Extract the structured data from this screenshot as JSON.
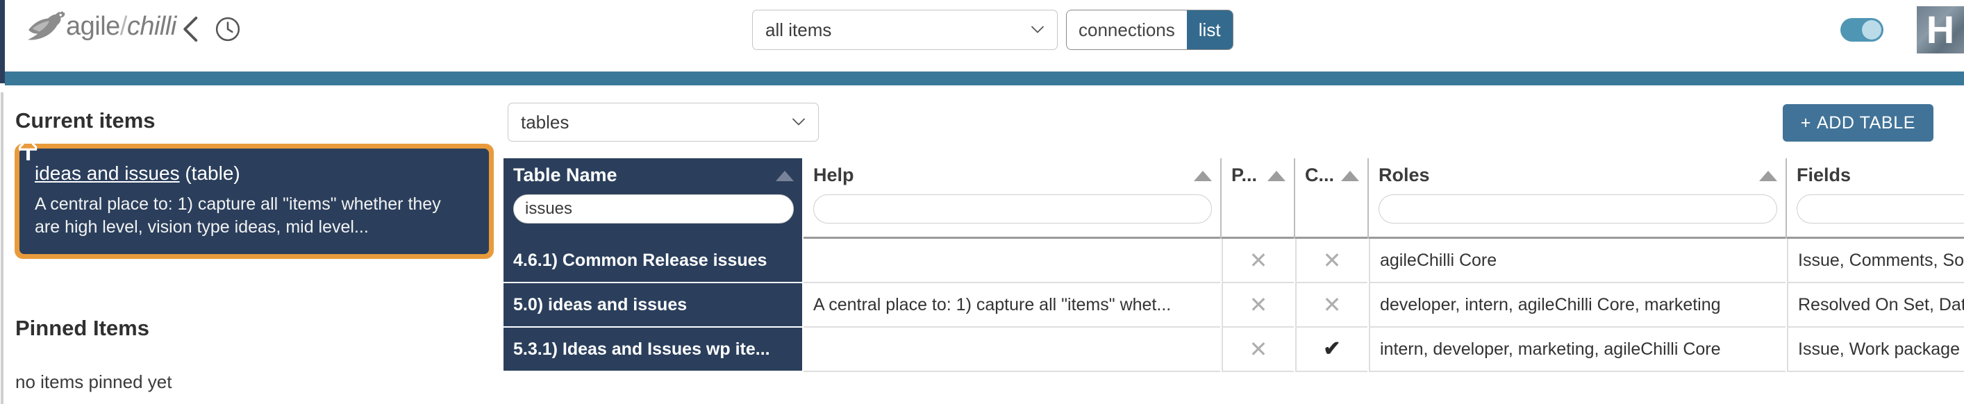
{
  "header": {
    "logo": {
      "brand_first": "agile",
      "slash": "/",
      "brand_second": "chilli",
      "icon": "bird-logo-icon"
    },
    "back_icon": "chevron-left-icon",
    "history_icon": "clock-icon",
    "scope_select": {
      "value": "all items",
      "caret_icon": "chevron-down-icon"
    },
    "view_toggle": {
      "left_label": "connections",
      "right_label": "list",
      "active": "list"
    },
    "theme_toggle": {
      "state": "on",
      "color": "#4f96b4"
    },
    "avatar": {
      "initial": "H"
    },
    "divider_color": "#3a7899"
  },
  "sidebar": {
    "current_heading": "Current items",
    "pinned_heading": "Pinned Items",
    "pinned_empty": "no items pinned yet",
    "card": {
      "pin_icon": "pushpin-icon",
      "link_text": "ideas and issues",
      "type_suffix": "(table)",
      "description": "A central place to: 1) capture all \"items\" whether they are high level, vision type ideas, mid level...",
      "border_color": "#e99b3c",
      "background_color": "#2b3f5c"
    }
  },
  "main": {
    "entity_select": {
      "value": "tables",
      "caret_icon": "chevron-down-icon"
    },
    "add_button": {
      "plus": "+",
      "label": "ADD TABLE",
      "color": "#417398"
    },
    "table": {
      "columns": [
        {
          "label": "Table Name",
          "sorted": true,
          "has_filter": true,
          "filter_value": "issues",
          "sort_icon": "sort-ascending-icon"
        },
        {
          "label": "Help",
          "sorted": false,
          "has_filter": true,
          "filter_value": "",
          "sort_icon": "sort-ascending-icon"
        },
        {
          "label": "P...",
          "sorted": false,
          "has_filter": false,
          "filter_value": "",
          "sort_icon": "sort-ascending-icon"
        },
        {
          "label": "C...",
          "sorted": false,
          "has_filter": false,
          "filter_value": "",
          "sort_icon": "sort-ascending-icon"
        },
        {
          "label": "Roles",
          "sorted": false,
          "has_filter": true,
          "filter_value": "",
          "sort_icon": "sort-ascending-icon"
        },
        {
          "label": "Fields",
          "sorted": false,
          "has_filter": true,
          "filter_value": "",
          "sort_icon": "sort-ascending-icon"
        }
      ],
      "rows": [
        {
          "name": "4.6.1) Common Release issues",
          "help": "",
          "p": "x",
          "c": "x",
          "roles": "agileChilli Core",
          "fields": "Issue, Comments, Solu"
        },
        {
          "name": "5.0) ideas and issues",
          "help": "A central place to: 1) capture all \"items\" whet...",
          "p": "x",
          "c": "x",
          "roles": "developer, intern, agileChilli Core, marketing",
          "fields": "Resolved On Set, Date"
        },
        {
          "name": "5.3.1) Ideas and Issues wp ite...",
          "help": "",
          "p": "x",
          "c": "check",
          "roles": "intern, developer, marketing, agileChilli Core",
          "fields": "Issue, Work package"
        }
      ],
      "mark_glyphs": {
        "x": "✕",
        "check": "✔"
      }
    }
  }
}
